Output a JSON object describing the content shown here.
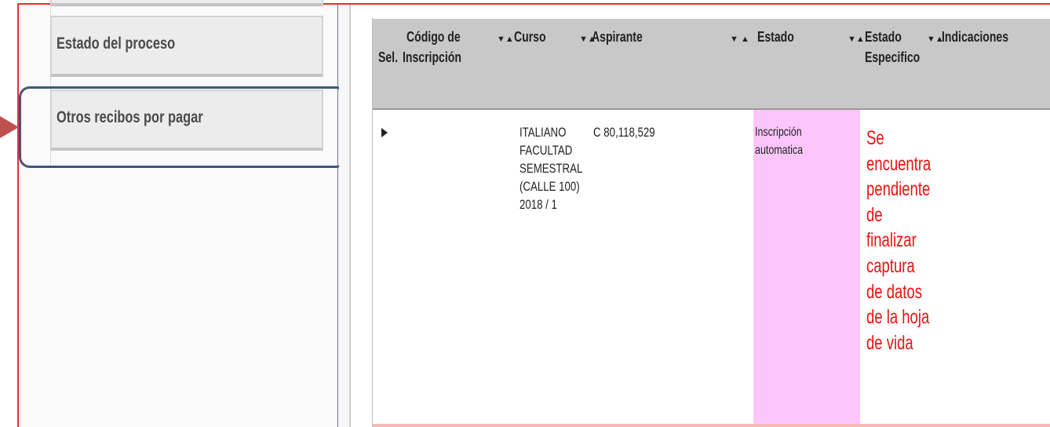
{
  "sidebar": {
    "items": [
      {
        "label": "Estado del proceso"
      },
      {
        "label": "Otros recibos por pagar"
      }
    ]
  },
  "table": {
    "headers": {
      "sel": "Sel.",
      "codigo_l1": "Código de",
      "codigo_l2": "Inscripción",
      "curso": "Curso",
      "aspirante": "Aspirante",
      "estado": "Estado",
      "estado_esp_l1": "Estado",
      "estado_esp_l2": "Especifico",
      "indicaciones": "Indicaciones"
    },
    "sort_glyphs": {
      "codigo": "▼▲",
      "curso": "▼▲",
      "aspirante": "▼ ▲",
      "estado": "▼▲",
      "estado_esp": "▼▲"
    },
    "row": {
      "curso_lines": [
        "ITALIANO",
        "FACULTAD",
        "SEMESTRAL",
        "(CALLE 100)",
        "2018 / 1"
      ],
      "aspirante": "C 80,118,529",
      "estado_lines": [
        "Inscripción",
        "automatica"
      ],
      "indicaciones_lines": [
        "Se",
        "encuentra",
        "pendiente",
        "de",
        "finalizar",
        "captura",
        "de datos",
        "de la hoja",
        "de vida"
      ]
    }
  },
  "colors": {
    "header_bg": "#c8c8c8",
    "estado_highlight": "#fcc6fc",
    "indicaciones_text": "#ee1111",
    "callout_border": "#3f5878",
    "callout_arrow": "#c0504d"
  }
}
